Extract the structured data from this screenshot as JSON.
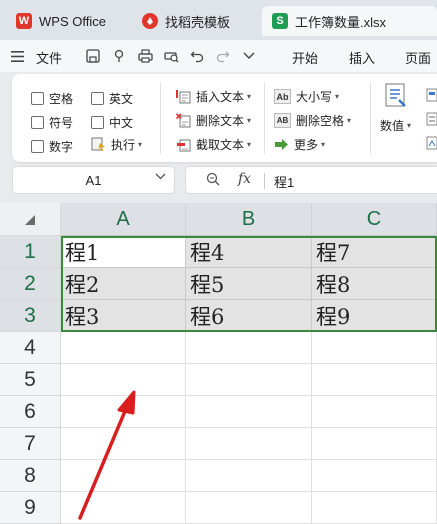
{
  "tabs": [
    {
      "label": "WPS Office",
      "icon": "wps-logo-icon"
    },
    {
      "label": "找稻壳模板",
      "icon": "docer-icon"
    },
    {
      "label": "工作簿数量.xlsx",
      "icon": "spreadsheet-s-icon",
      "icon_text": "S"
    }
  ],
  "menu": {
    "file": "文件",
    "home": "开始",
    "insert": "插入",
    "page": "页面"
  },
  "ribbon": {
    "space": "空格",
    "english": "英文",
    "symbol": "符号",
    "chinese": "中文",
    "number": "数字",
    "execute": "执行",
    "insert_text": "插入文本",
    "delete_text": "删除文本",
    "extract_text": "截取文本",
    "case": "大小写",
    "delete_space": "删除空格",
    "more": "更多",
    "numeric": "数值",
    "icons": {
      "case": "Ab",
      "delete_space": "AB"
    }
  },
  "formula_bar": {
    "name_box": "A1",
    "fx": "fx",
    "value": "程1"
  },
  "grid": {
    "columns": [
      "A",
      "B",
      "C"
    ],
    "rows": [
      "1",
      "2",
      "3",
      "4",
      "5",
      "6",
      "7",
      "8",
      "9"
    ],
    "cells": [
      [
        "程1",
        "程4",
        "程7"
      ],
      [
        "程2",
        "程5",
        "程8"
      ],
      [
        "程3",
        "程6",
        "程9"
      ]
    ]
  },
  "colors": {
    "accent_green": "#1e6f45",
    "selection_border": "#3b8a3b",
    "wps_red": "#e0362c",
    "arrow_red": "#d81e1e"
  }
}
